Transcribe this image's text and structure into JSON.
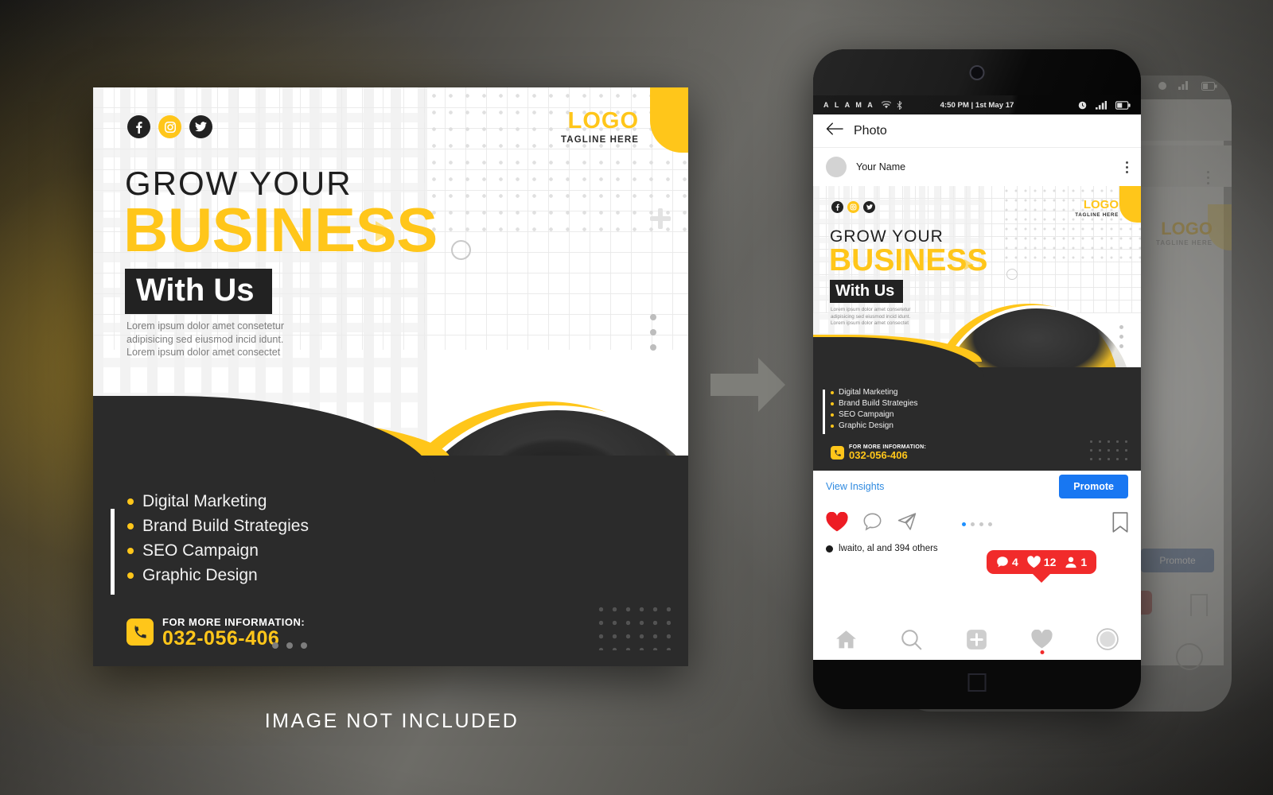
{
  "poster": {
    "social_icons": [
      "facebook-icon",
      "instagram-icon",
      "twitter-icon"
    ],
    "logo": {
      "name": "LOGO",
      "tagline": "TAGLINE HERE"
    },
    "headline_small": "GROW YOUR",
    "headline_big": "BUSINESS",
    "headline_badge": "With Us",
    "body_copy": "Lorem ipsum dolor amet consetetur adipisicing sed eiusmod incid idunt. Lorem ipsum dolor amet consectet",
    "bullets": [
      "Digital Marketing",
      "Brand Build Strategies",
      "SEO Campaign",
      "Graphic Design"
    ],
    "contact_label": "FOR MORE INFORMATION:",
    "contact_number": "032-056-406",
    "colors": {
      "accent": "#FFC61A",
      "dark": "#2B2B2B",
      "white": "#FFFFFF"
    }
  },
  "phone": {
    "statusbar": {
      "carrier": "A L A M A",
      "wifi_icon": "wifi-icon",
      "bluetooth_icon": "bluetooth-icon",
      "time": "4:50 PM | 1st May 17",
      "alarm_icon": "clock-icon",
      "signal_icon": "signal-icon",
      "battery_icon": "battery-icon"
    },
    "app_header": {
      "back_icon": "back-arrow-icon",
      "title": "Photo"
    },
    "post_header": {
      "avatar": "avatar",
      "name": "Your Name",
      "menu_icon": "kebab-menu-icon"
    },
    "insights": {
      "link": "View Insights",
      "promote_button": "Promote"
    },
    "actions": {
      "like_icon": "heart-filled-icon",
      "comment_icon": "comment-icon",
      "share_icon": "share-icon",
      "bookmark_icon": "bookmark-icon"
    },
    "notification": {
      "comments": "4",
      "likes": "12",
      "followers": "1",
      "color": "#F12B2B"
    },
    "likes_text": "lwaito, al  and 394 others",
    "bottom_nav": [
      "home-icon",
      "search-icon",
      "add-icon",
      "activity-heart-icon",
      "profile-icon"
    ],
    "home_button": "home-square-button"
  },
  "arrow": {
    "name": "right-arrow-icon",
    "color": "#7E7E79"
  },
  "caption": "IMAGE NOT INCLUDED"
}
